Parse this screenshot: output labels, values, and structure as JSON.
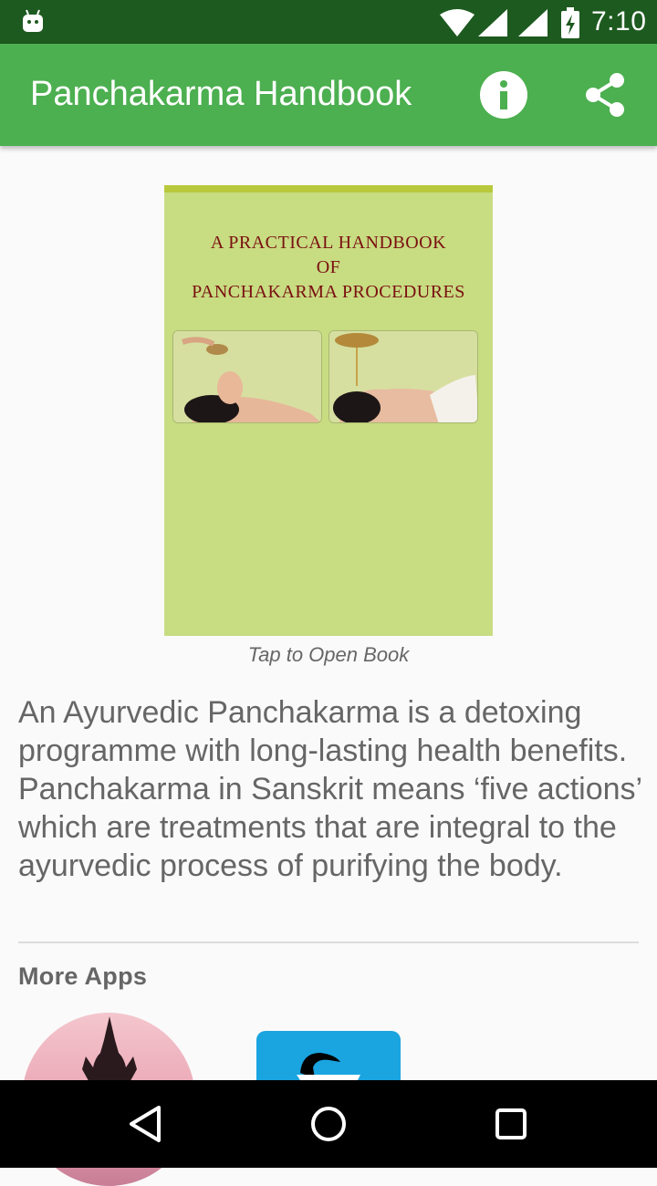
{
  "status_bar": {
    "time": "7:10",
    "icons": [
      "android-icon",
      "wifi-icon",
      "signal-icon",
      "signal-icon",
      "battery-charging-icon"
    ]
  },
  "app_bar": {
    "title": "Panchakarma Handbook",
    "actions": [
      "info-icon",
      "share-icon"
    ],
    "color": "#4caf50"
  },
  "book": {
    "cover_lines": [
      "A PRACTICAL HANDBOOK",
      "OF",
      "PANCHAKARMA PROCEDURES"
    ],
    "caption": "Tap to Open Book",
    "cover_color": "#c8dc82"
  },
  "description": "An Ayurvedic Panchakarma is a detoxing programme with long-lasting health benefits. Panchakarma in Sanskrit means ‘five actions’ which are treatments that are integral to the ayurvedic process of purifying the body.",
  "more_apps": {
    "heading": "More Apps",
    "apps": [
      "yoga-app-icon",
      "swan-app-icon"
    ]
  },
  "nav_bar": {
    "buttons": [
      "back-icon",
      "home-icon",
      "recents-icon"
    ]
  }
}
